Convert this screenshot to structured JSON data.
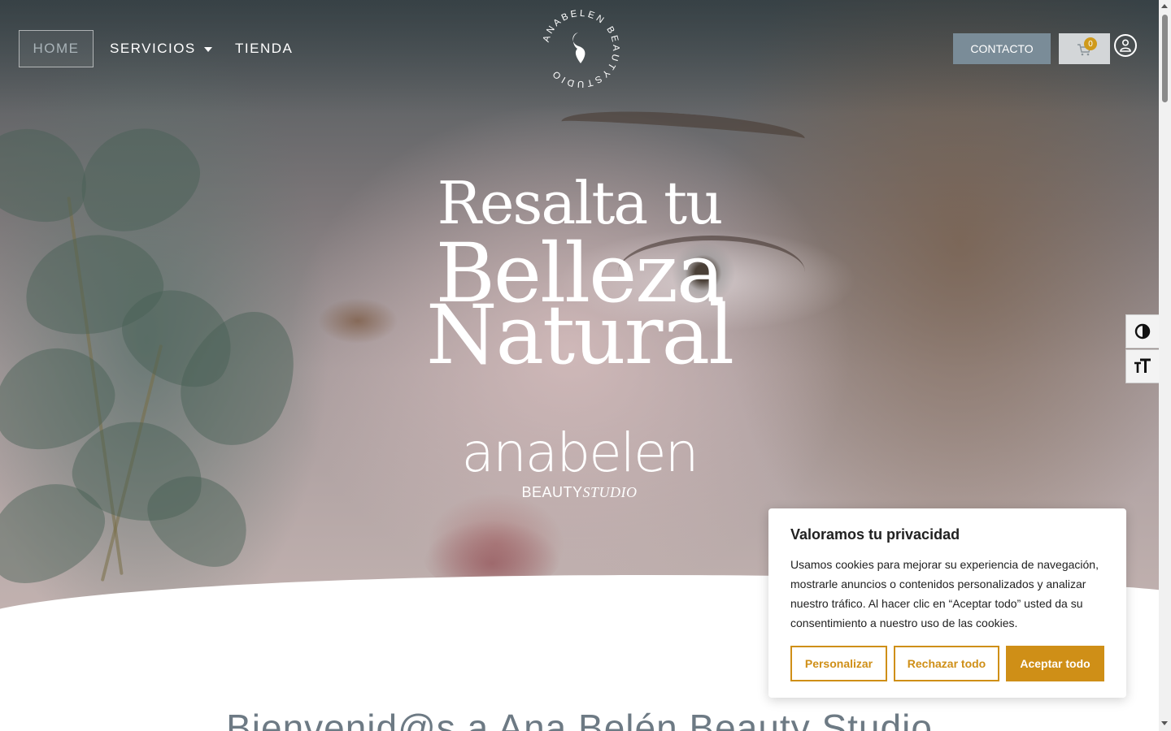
{
  "nav": {
    "home": "HOME",
    "servicios": "SERVICIOS",
    "tienda": "TIENDA",
    "contacto": "CONTACTO",
    "cart_count": "0"
  },
  "logo": {
    "ring_text": "ANABELEN BEAUTYSTUDIO"
  },
  "hero": {
    "line1": "Resalta tu",
    "line2": "Belleza",
    "line3": "Natural",
    "brand": "anabelen",
    "brand_sub_a": "BEAUTY",
    "brand_sub_b": "STUDIO"
  },
  "welcome": {
    "heading": "Bienvenid@s a Ana Belén Beauty Studio"
  },
  "cookie": {
    "title": "Valoramos tu privacidad",
    "text": "Usamos cookies para mejorar su experiencia de navegación, mostrarle anuncios o contenidos personalizados y analizar nuestro tráfico. Al hacer clic en “Aceptar todo” usted da su consentimiento a nuestro uso de las cookies.",
    "customize": "Personalizar",
    "reject": "Rechazar todo",
    "accept": "Aceptar todo"
  },
  "colors": {
    "accent": "#cf8f17",
    "contact_button": "#7a8c98",
    "welcome_text": "#6d7a84"
  },
  "icons": [
    "cart-icon",
    "user-icon",
    "contrast-icon",
    "font-size-icon",
    "chevron-down-icon"
  ]
}
